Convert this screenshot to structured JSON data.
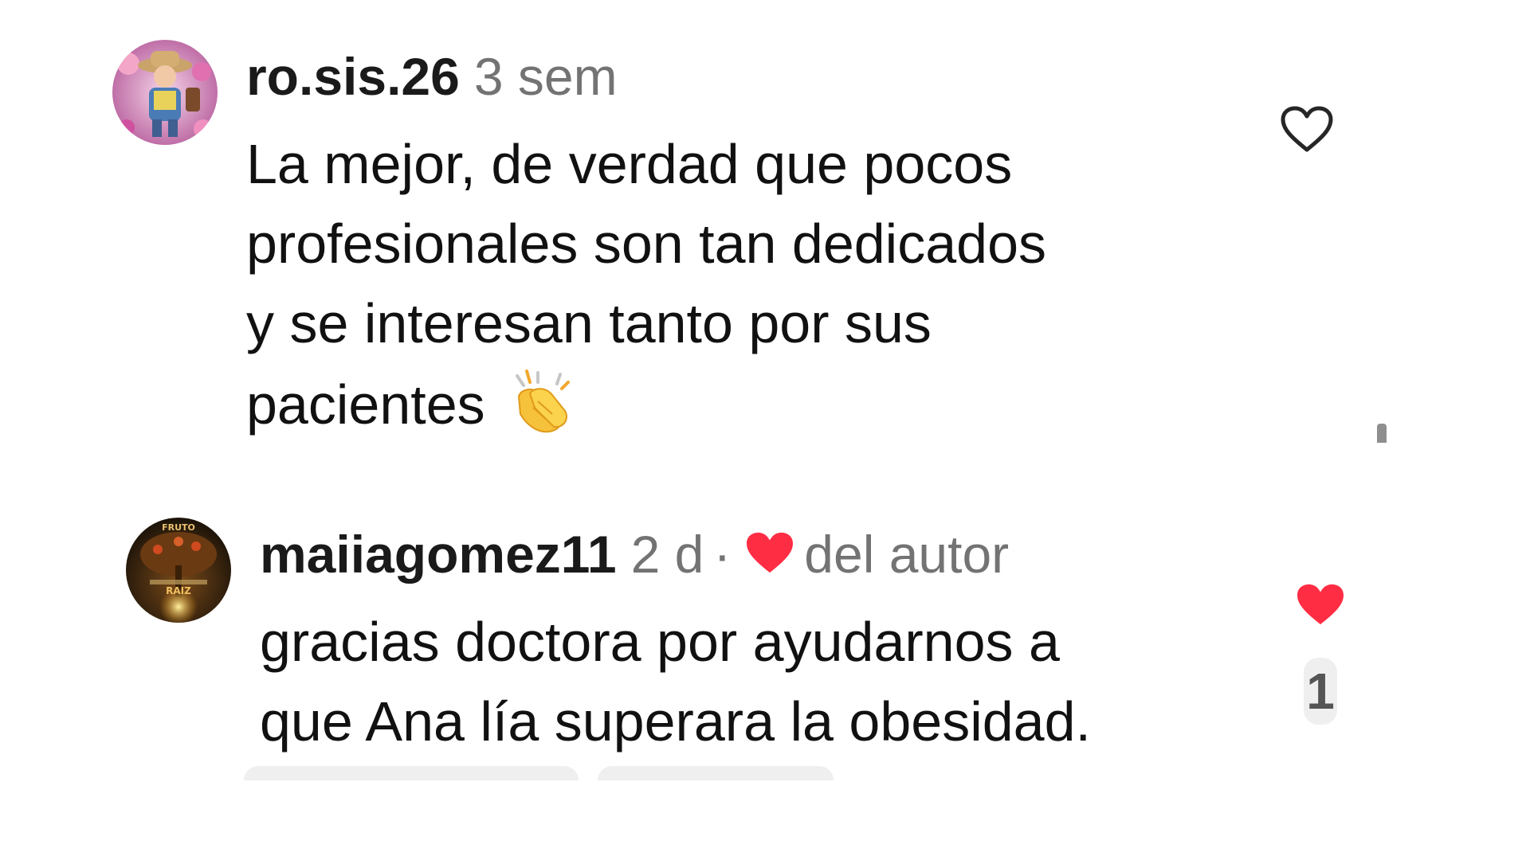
{
  "comments": [
    {
      "username": "ro.sis.26",
      "time": "3 sem",
      "text_lines": [
        "La mejor, de verdad que pocos",
        "profesionales son tan dedicados",
        "y se interesan tanto por sus",
        "pacientes"
      ],
      "emoji": "clapping-hands-emoji",
      "liked": false,
      "avatar": "child-in-costume-avatar"
    },
    {
      "username": "maiiagomez11",
      "time": "2 d",
      "separator": "·",
      "author_label": "del autor",
      "text_lines": [
        "gracias doctora por ayudarnos a",
        "que Ana lía superara la obesidad."
      ],
      "liked": true,
      "like_count": "1",
      "avatar_text_top": "FRUTO",
      "avatar_text_bottom": "RAIZ"
    }
  ],
  "colors": {
    "heart_red": "#ff2d43",
    "secondary_text": "#737373",
    "primary_text": "#111111"
  }
}
